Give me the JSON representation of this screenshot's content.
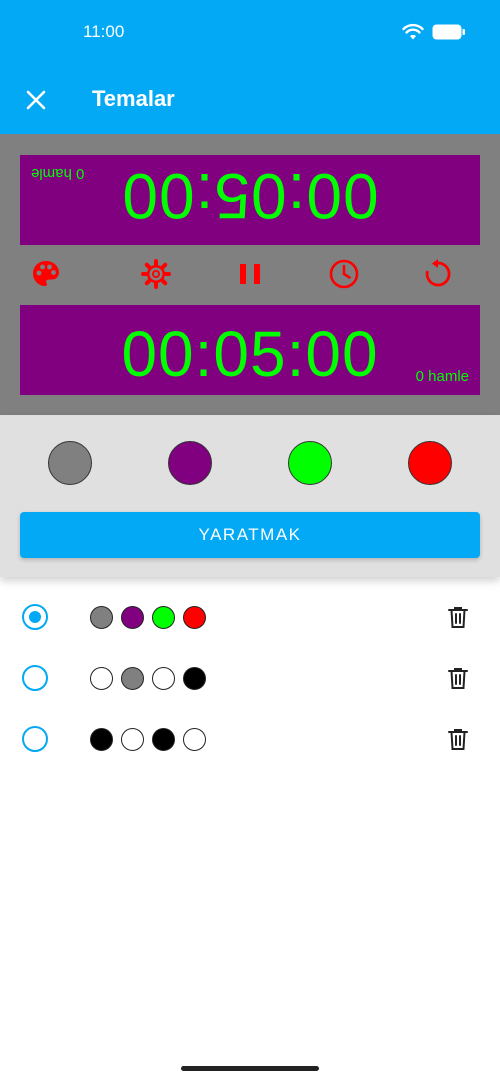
{
  "status_bar": {
    "time": "11:00"
  },
  "header": {
    "title": "Temalar"
  },
  "preview": {
    "top_clock": {
      "time": "00:05:00",
      "moves": "0 hamle"
    },
    "bottom_clock": {
      "time": "00:05:00",
      "moves": "0 hamle"
    },
    "controls": [
      "palette-icon",
      "settings-icon",
      "pause-icon",
      "clock-icon",
      "reset-icon"
    ],
    "colors": {
      "background": "#808080",
      "panel": "#800080",
      "text": "#00FF00",
      "buttons": "#FF0000"
    }
  },
  "editor": {
    "swatches": [
      "#808080",
      "#800080",
      "#00FF00",
      "#FF0000"
    ],
    "create_label": "YARATMAK"
  },
  "themes": [
    {
      "selected": true,
      "colors": [
        "#808080",
        "#800080",
        "#00FF00",
        "#FF0000"
      ]
    },
    {
      "selected": false,
      "colors": [
        "#FFFFFF",
        "#808080",
        "#FFFFFF",
        "#000000"
      ]
    },
    {
      "selected": false,
      "colors": [
        "#000000",
        "#FFFFFF",
        "#000000",
        "#FFFFFF"
      ]
    }
  ],
  "accent_color": "#03A9F4"
}
